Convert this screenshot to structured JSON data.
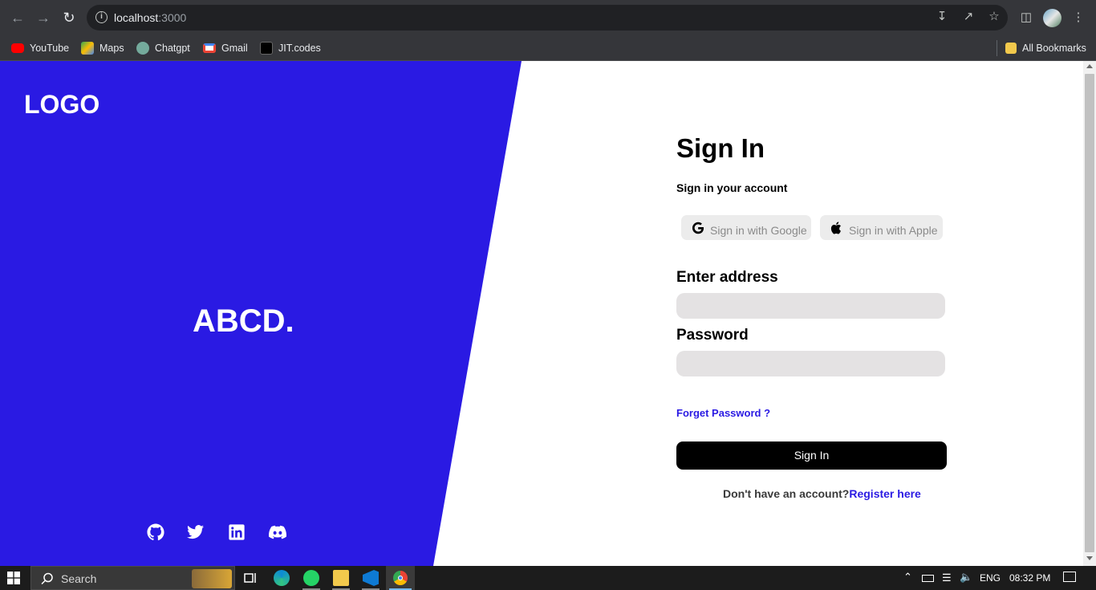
{
  "browser": {
    "url_host": "localhost",
    "url_port": ":3000",
    "bookmarks": [
      {
        "label": "YouTube",
        "color": "#ff0000"
      },
      {
        "label": "Maps",
        "color": "#34a853"
      },
      {
        "label": "Chatgpt",
        "color": "#74aa9c"
      },
      {
        "label": "Gmail",
        "color": "#ea4335"
      },
      {
        "label": "JIT.codes",
        "color": "#000000"
      }
    ],
    "all_bookmarks": "All Bookmarks"
  },
  "left_panel": {
    "logo": "LOGO",
    "brand": "ABCD.",
    "accent_color": "#2a1ae3",
    "social_icons": [
      "github-icon",
      "twitter-icon",
      "linkedin-icon",
      "discord-icon"
    ]
  },
  "signin": {
    "title": "Sign In",
    "subtitle": "Sign in your account",
    "google_label": "Sign in with Google",
    "apple_label": "Sign in with Apple",
    "address_label": "Enter address",
    "address_value": "",
    "password_label": "Password",
    "password_value": "",
    "forgot_label": "Forget Password ?",
    "submit_label": "Sign In",
    "register_prompt": "Don't have an account?",
    "register_link": "Register here"
  },
  "taskbar": {
    "search_placeholder": "Search",
    "language": "ENG",
    "time": "08:32 PM"
  }
}
